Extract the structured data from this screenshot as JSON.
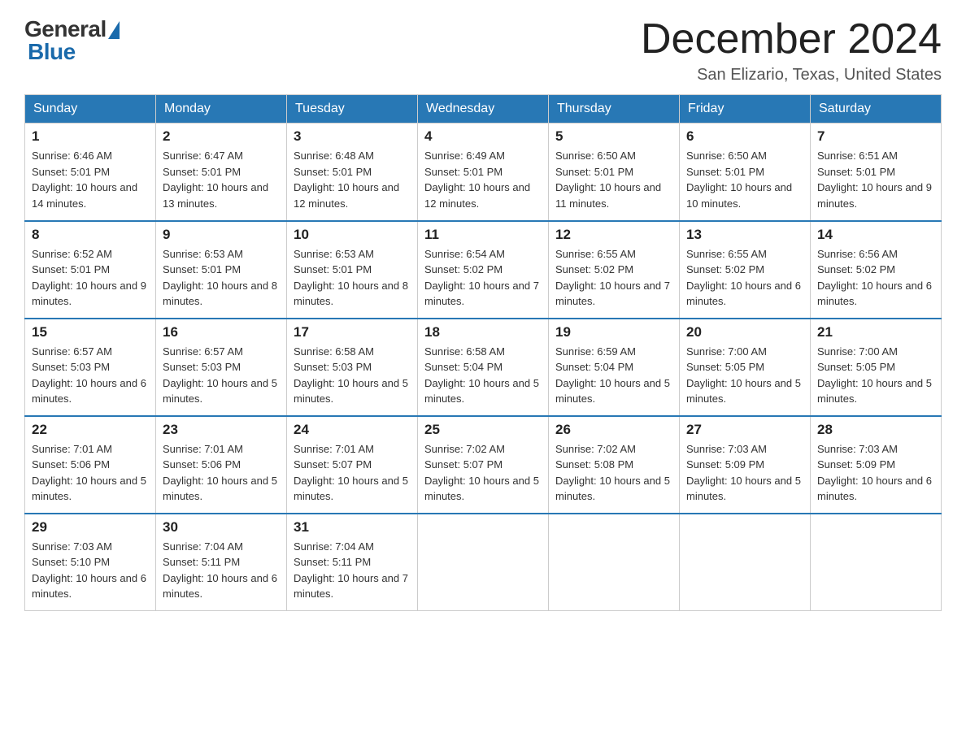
{
  "logo": {
    "general": "General",
    "blue": "Blue"
  },
  "title": "December 2024",
  "subtitle": "San Elizario, Texas, United States",
  "days_of_week": [
    "Sunday",
    "Monday",
    "Tuesday",
    "Wednesday",
    "Thursday",
    "Friday",
    "Saturday"
  ],
  "weeks": [
    [
      {
        "day": "1",
        "sunrise": "6:46 AM",
        "sunset": "5:01 PM",
        "daylight": "10 hours and 14 minutes."
      },
      {
        "day": "2",
        "sunrise": "6:47 AM",
        "sunset": "5:01 PM",
        "daylight": "10 hours and 13 minutes."
      },
      {
        "day": "3",
        "sunrise": "6:48 AM",
        "sunset": "5:01 PM",
        "daylight": "10 hours and 12 minutes."
      },
      {
        "day": "4",
        "sunrise": "6:49 AM",
        "sunset": "5:01 PM",
        "daylight": "10 hours and 12 minutes."
      },
      {
        "day": "5",
        "sunrise": "6:50 AM",
        "sunset": "5:01 PM",
        "daylight": "10 hours and 11 minutes."
      },
      {
        "day": "6",
        "sunrise": "6:50 AM",
        "sunset": "5:01 PM",
        "daylight": "10 hours and 10 minutes."
      },
      {
        "day": "7",
        "sunrise": "6:51 AM",
        "sunset": "5:01 PM",
        "daylight": "10 hours and 9 minutes."
      }
    ],
    [
      {
        "day": "8",
        "sunrise": "6:52 AM",
        "sunset": "5:01 PM",
        "daylight": "10 hours and 9 minutes."
      },
      {
        "day": "9",
        "sunrise": "6:53 AM",
        "sunset": "5:01 PM",
        "daylight": "10 hours and 8 minutes."
      },
      {
        "day": "10",
        "sunrise": "6:53 AM",
        "sunset": "5:01 PM",
        "daylight": "10 hours and 8 minutes."
      },
      {
        "day": "11",
        "sunrise": "6:54 AM",
        "sunset": "5:02 PM",
        "daylight": "10 hours and 7 minutes."
      },
      {
        "day": "12",
        "sunrise": "6:55 AM",
        "sunset": "5:02 PM",
        "daylight": "10 hours and 7 minutes."
      },
      {
        "day": "13",
        "sunrise": "6:55 AM",
        "sunset": "5:02 PM",
        "daylight": "10 hours and 6 minutes."
      },
      {
        "day": "14",
        "sunrise": "6:56 AM",
        "sunset": "5:02 PM",
        "daylight": "10 hours and 6 minutes."
      }
    ],
    [
      {
        "day": "15",
        "sunrise": "6:57 AM",
        "sunset": "5:03 PM",
        "daylight": "10 hours and 6 minutes."
      },
      {
        "day": "16",
        "sunrise": "6:57 AM",
        "sunset": "5:03 PM",
        "daylight": "10 hours and 5 minutes."
      },
      {
        "day": "17",
        "sunrise": "6:58 AM",
        "sunset": "5:03 PM",
        "daylight": "10 hours and 5 minutes."
      },
      {
        "day": "18",
        "sunrise": "6:58 AM",
        "sunset": "5:04 PM",
        "daylight": "10 hours and 5 minutes."
      },
      {
        "day": "19",
        "sunrise": "6:59 AM",
        "sunset": "5:04 PM",
        "daylight": "10 hours and 5 minutes."
      },
      {
        "day": "20",
        "sunrise": "7:00 AM",
        "sunset": "5:05 PM",
        "daylight": "10 hours and 5 minutes."
      },
      {
        "day": "21",
        "sunrise": "7:00 AM",
        "sunset": "5:05 PM",
        "daylight": "10 hours and 5 minutes."
      }
    ],
    [
      {
        "day": "22",
        "sunrise": "7:01 AM",
        "sunset": "5:06 PM",
        "daylight": "10 hours and 5 minutes."
      },
      {
        "day": "23",
        "sunrise": "7:01 AM",
        "sunset": "5:06 PM",
        "daylight": "10 hours and 5 minutes."
      },
      {
        "day": "24",
        "sunrise": "7:01 AM",
        "sunset": "5:07 PM",
        "daylight": "10 hours and 5 minutes."
      },
      {
        "day": "25",
        "sunrise": "7:02 AM",
        "sunset": "5:07 PM",
        "daylight": "10 hours and 5 minutes."
      },
      {
        "day": "26",
        "sunrise": "7:02 AM",
        "sunset": "5:08 PM",
        "daylight": "10 hours and 5 minutes."
      },
      {
        "day": "27",
        "sunrise": "7:03 AM",
        "sunset": "5:09 PM",
        "daylight": "10 hours and 5 minutes."
      },
      {
        "day": "28",
        "sunrise": "7:03 AM",
        "sunset": "5:09 PM",
        "daylight": "10 hours and 6 minutes."
      }
    ],
    [
      {
        "day": "29",
        "sunrise": "7:03 AM",
        "sunset": "5:10 PM",
        "daylight": "10 hours and 6 minutes."
      },
      {
        "day": "30",
        "sunrise": "7:04 AM",
        "sunset": "5:11 PM",
        "daylight": "10 hours and 6 minutes."
      },
      {
        "day": "31",
        "sunrise": "7:04 AM",
        "sunset": "5:11 PM",
        "daylight": "10 hours and 7 minutes."
      },
      null,
      null,
      null,
      null
    ]
  ]
}
